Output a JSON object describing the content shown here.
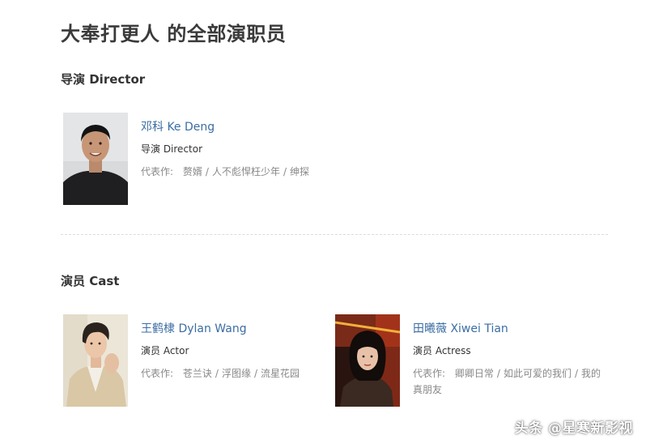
{
  "page": {
    "title": "大奉打更人 的全部演职员"
  },
  "sections": {
    "director": {
      "title": "导演 Director",
      "people": [
        {
          "name": "邓科 Ke Deng",
          "role": "导演 Director",
          "works_label": "代表作:",
          "works": [
            "赘婿",
            "人不彪悍枉少年",
            "绅探"
          ]
        }
      ]
    },
    "cast": {
      "title": "演员 Cast",
      "people": [
        {
          "name": "王鹤棣 Dylan Wang",
          "role": "演员 Actor",
          "works_label": "代表作:",
          "works": [
            "苍兰诀",
            "浮图缘",
            "流星花园"
          ]
        },
        {
          "name": "田曦薇 Xiwei Tian",
          "role": "演员 Actress",
          "works_label": "代表作:",
          "works": [
            "卿卿日常",
            "如此可爱的我们",
            "我的真朋友"
          ]
        }
      ]
    }
  },
  "watermark": "头条 @星寒新影视",
  "colors": {
    "link": "#3b6da3",
    "muted": "#888888",
    "title": "#3a3a3a"
  }
}
